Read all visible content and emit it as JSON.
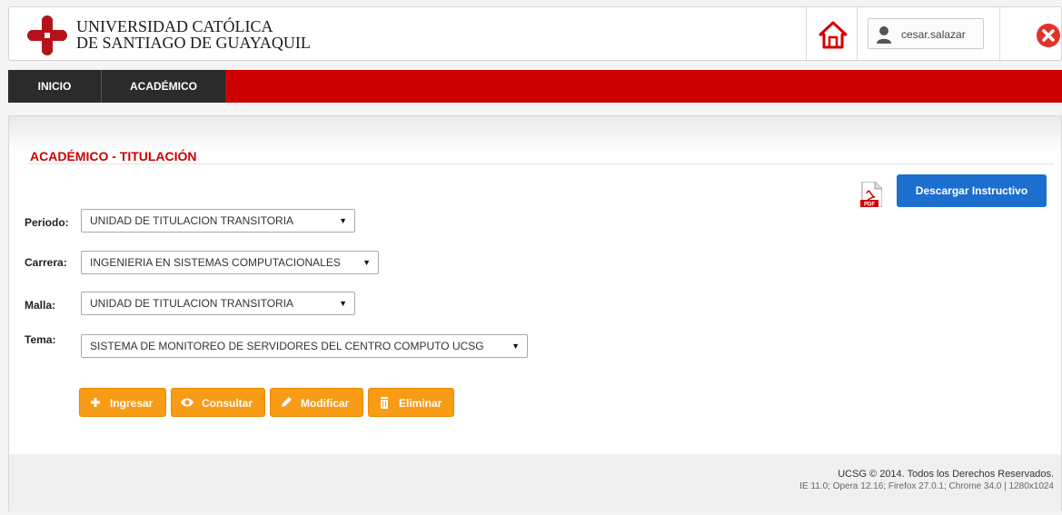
{
  "header": {
    "university_line1": "UNIVERSIDAD CATÓLICA",
    "university_line2": "DE SANTIAGO DE GUAYAQUIL",
    "username": "cesar.salazar"
  },
  "nav": {
    "items": [
      {
        "label": "INICIO"
      },
      {
        "label": "ACADÉMICO"
      }
    ]
  },
  "main": {
    "title": "ACADÉMICO - TITULACIÓN",
    "download_button": "Descargar Instructivo",
    "form": {
      "periodo": {
        "label": "Periodo:",
        "value": "UNIDAD DE TITULACION TRANSITORIA"
      },
      "carrera": {
        "label": "Carrera:",
        "value": "INGENIERIA EN SISTEMAS COMPUTACIONALES"
      },
      "malla": {
        "label": "Malla:",
        "value": "UNIDAD DE TITULACION TRANSITORIA"
      },
      "tema": {
        "label": "Tema:",
        "value": "SISTEMA DE MONITOREO DE SERVIDORES DEL CENTRO COMPUTO UCSG"
      }
    },
    "actions": {
      "ingresar": "Ingresar",
      "consultar": "Consultar",
      "modificar": "Modificar",
      "eliminar": "Eliminar"
    }
  },
  "footer": {
    "copyright": "UCSG © 2014. Todos los Derechos Reservados.",
    "compat": "IE 11.0; Opera 12.16; Firefox 27.0.1; Chrome 34.0 | 1280x1024"
  },
  "colors": {
    "brand_red": "#cc0000",
    "nav_dark": "#2b2b2b",
    "action_orange": "#f89b15",
    "download_blue": "#1d6fcf"
  },
  "icons": {
    "logo": "university-cross-logo",
    "home": "home-icon",
    "user": "user-icon",
    "close": "close-icon",
    "pdf": "pdf-icon",
    "ingresar": "plus-icon",
    "consultar": "eye-icon",
    "modificar": "pencil-icon",
    "eliminar": "trash-icon"
  }
}
